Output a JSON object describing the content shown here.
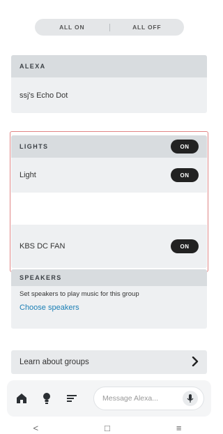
{
  "top_controls": {
    "all_on": "ALL ON",
    "all_off": "ALL OFF"
  },
  "alexa": {
    "header": "ALEXA",
    "device": "ssj's Echo Dot"
  },
  "lights": {
    "header": "LIGHTS",
    "header_toggle": "ON",
    "items": [
      {
        "label": "Light",
        "toggle": "ON"
      },
      {
        "label": "KBS DC FAN",
        "toggle": "ON"
      }
    ]
  },
  "speakers": {
    "header": "SPEAKERS",
    "description": "Set speakers to play music for this group",
    "link": "Choose speakers"
  },
  "learn": {
    "label": "Learn about groups",
    "icon": "chevron-right-icon"
  },
  "bottom_bar": {
    "icons": [
      "home-icon",
      "lightbulb-icon",
      "list-icon"
    ],
    "message_placeholder": "Message Alexa...",
    "mic_icon": "microphone-icon"
  },
  "system_nav": {
    "back": "<",
    "home": "□",
    "menu": "≡"
  },
  "colors": {
    "link": "#1b7fb5",
    "toggle_on": "#222222",
    "selection": "#e08585"
  }
}
